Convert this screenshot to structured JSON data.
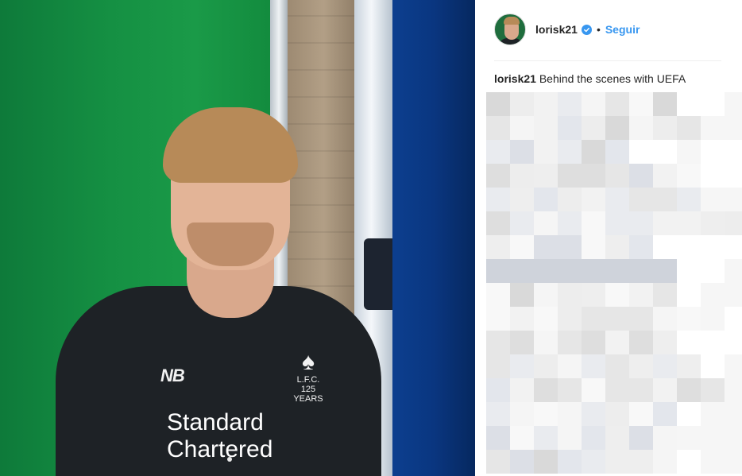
{
  "post": {
    "photo": {
      "subject": "man-in-black-goalkeeper-jersey",
      "sponsor_line_1": "Standard",
      "sponsor_line_2": "Chartered",
      "crest_text": "L.F.C.",
      "crest_years": "125 YEARS",
      "kit_brand": "NB",
      "carousel": {
        "current": 1,
        "total": 1
      }
    },
    "header": {
      "username": "lorisk21",
      "verified": true,
      "separator": "•",
      "follow_label": "Seguir"
    },
    "caption": {
      "username": "lorisk21",
      "text": "Behind the scenes with UEFA"
    },
    "comments_area": {
      "state": "pixelated"
    }
  },
  "colors": {
    "accent": "#3897f0",
    "text": "#262626",
    "divider": "#efefef"
  },
  "icons": {
    "verified": "verified-badge-icon"
  }
}
